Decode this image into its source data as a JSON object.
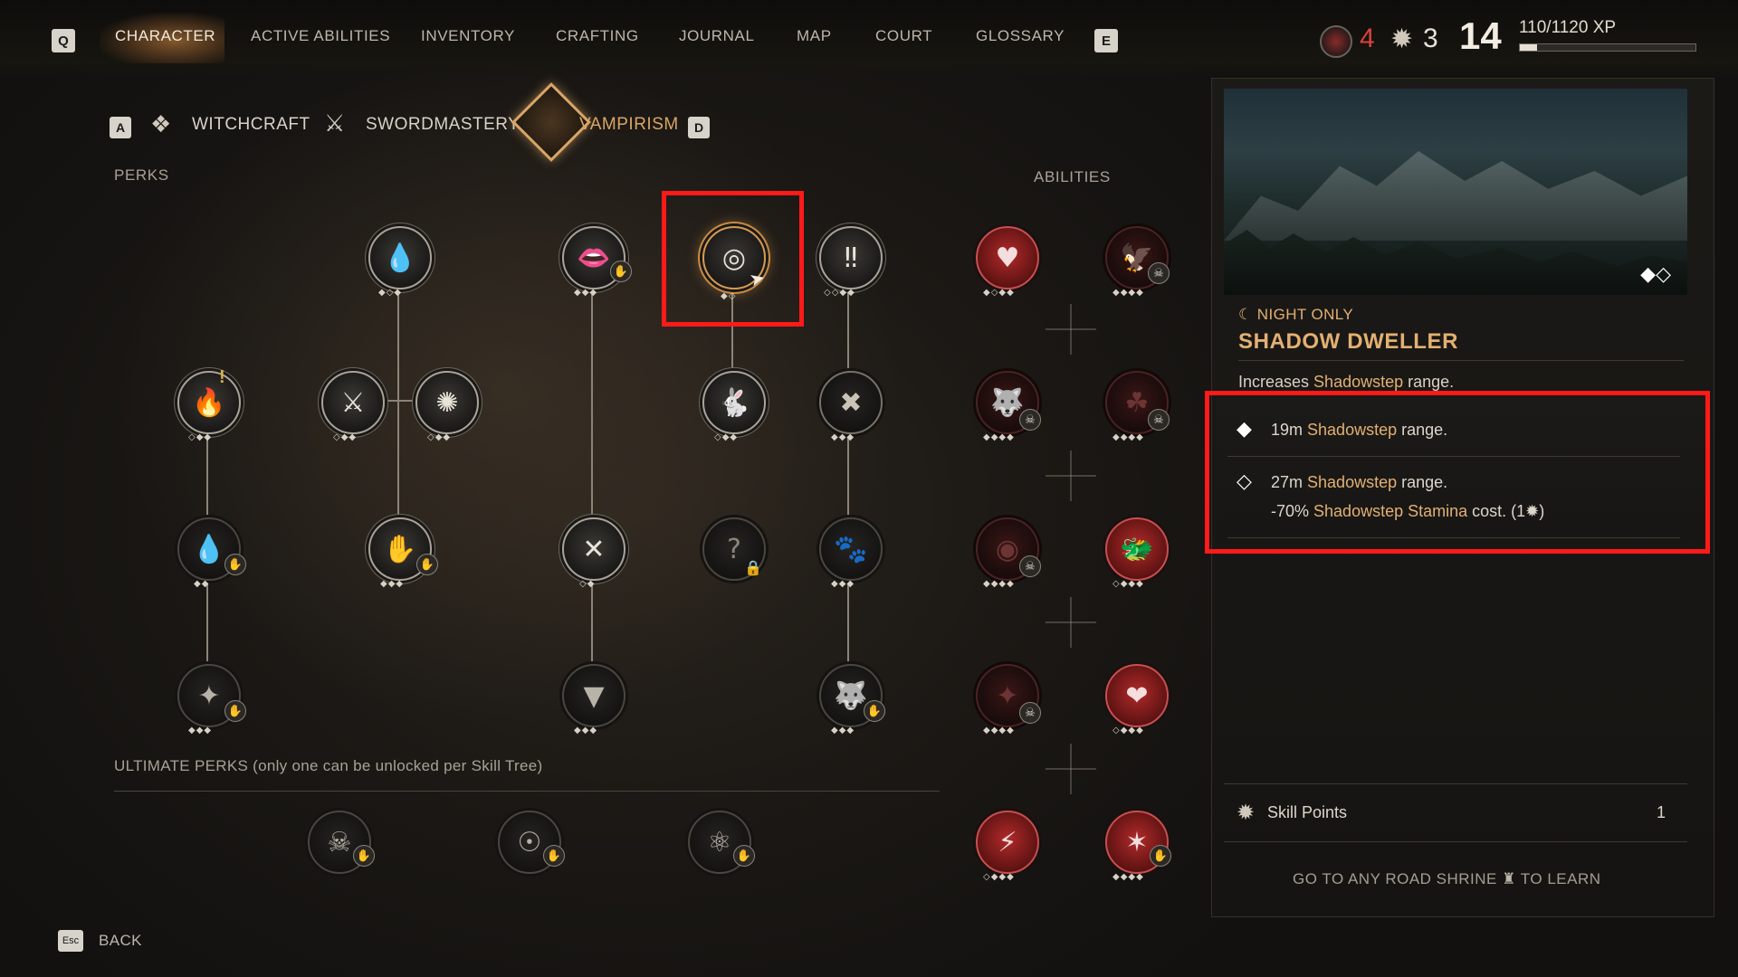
{
  "top_nav": {
    "left_key": "Q",
    "right_key": "E",
    "items": [
      {
        "label": "CHARACTER"
      },
      {
        "label": "ACTIVE ABILITIES"
      },
      {
        "label": "INVENTORY"
      },
      {
        "label": "CRAFTING"
      },
      {
        "label": "JOURNAL"
      },
      {
        "label": "MAP"
      },
      {
        "label": "COURT"
      },
      {
        "label": "GLOSSARY"
      }
    ],
    "active_item": "CHARACTER"
  },
  "status": {
    "counter_a": "4",
    "counter_a_icon": "blood-orb-icon",
    "counter_b": "3",
    "counter_b_icon": "skill-point-icon",
    "level": "14",
    "xp_text": "110/1120 XP",
    "xp_progress": 0.098
  },
  "tree_tabs": {
    "left_key": "A",
    "right_key": "D",
    "items": [
      {
        "label": "WITCHCRAFT",
        "icon": "witchcraft-icon"
      },
      {
        "label": "SWORDMASTERY",
        "icon": "sword-icon"
      },
      {
        "label": "VAMPIRISM",
        "icon": "fangs-icon"
      }
    ],
    "active": "VAMPIRISM"
  },
  "labels": {
    "perks": "PERKS",
    "abilities": "ABILITIES",
    "ultimate": "ULTIMATE PERKS (only one can be unlocked per Skill Tree)",
    "back_key": "Esc",
    "back": "BACK"
  },
  "perk_glyphs": {
    "p1": "💧",
    "p2": "👄",
    "p3": "◎",
    "p4": "‼",
    "p5": "🔥",
    "p6": "⚔",
    "p7": "✺",
    "p8": "🐇",
    "p9": "✖",
    "p10": "💧",
    "p11": "✋",
    "p12": "✕",
    "p13": "?",
    "p14": "🐾",
    "p15": "✦",
    "p16": "▼",
    "p17": "🐺",
    "u1": "☠",
    "u2": "☉",
    "u3": "⚛"
  },
  "ability_glyphs": {
    "a1": "♥",
    "a2": "🦅",
    "a3": "🐺",
    "a4": "☘",
    "a5": "◉",
    "a6": "🐲",
    "a7": "✦",
    "a8": "❤",
    "a9": "⚡",
    "a10": "✶"
  },
  "detail": {
    "tag": "NIGHT ONLY",
    "tag_icon": "moon-icon",
    "title": "SHADOW DWELLER",
    "desc_pre": "Increases ",
    "desc_hl": "Shadowstep",
    "desc_post": " range.",
    "rank1_pre": "19m ",
    "rank1_hl": "Shadowstep",
    "rank1_post": " range.",
    "rank2_pre": "27m ",
    "rank2_hl": "Shadowstep",
    "rank2_post": " range.",
    "rank2b_pre": "-70% ",
    "rank2b_hl": "Shadowstep Stamina",
    "rank2b_post": " cost.  (1",
    "rank2b_end": ")",
    "skill_points_label": "Skill Points",
    "skill_points_value": "1",
    "learn_pre": "GO TO ANY ROAD SHRINE",
    "learn_post": "TO LEARN"
  },
  "colors": {
    "accent": "#d9a565",
    "highlight": "#e3b072",
    "callout": "#ff1a1a",
    "ability_red": "#b22a2a"
  }
}
